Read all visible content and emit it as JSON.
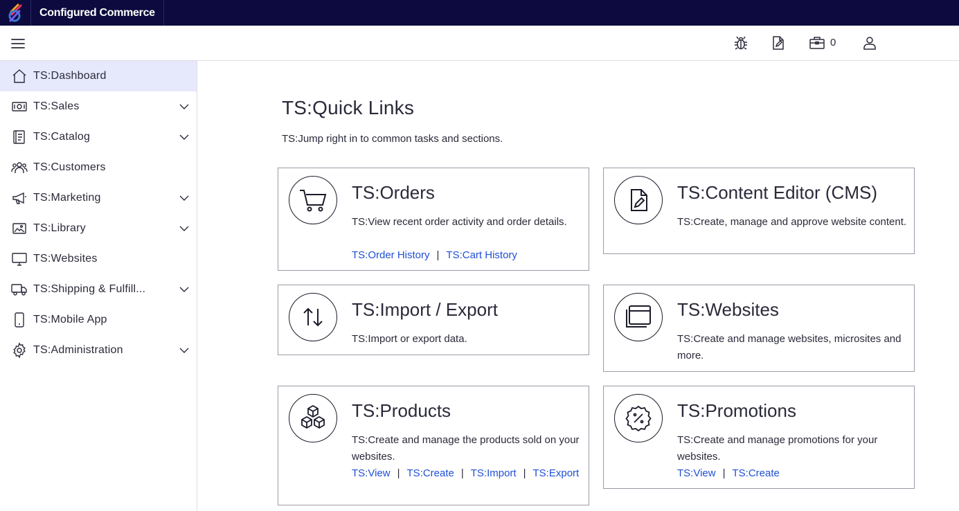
{
  "header": {
    "brand": "Configured Commerce",
    "cart_count": "0"
  },
  "icons": {
    "logo": "brand-logo-icon",
    "menu": "hamburger-menu-icon",
    "bug": "bug-icon",
    "notes": "document-edit-icon",
    "cart": "briefcase-cart-icon",
    "user": "user-icon"
  },
  "sidebar": {
    "items": [
      {
        "label": "TS:Dashboard",
        "icon": "home-icon",
        "active": true,
        "expandable": false
      },
      {
        "label": "TS:Sales",
        "icon": "money-icon",
        "expandable": true
      },
      {
        "label": "TS:Catalog",
        "icon": "catalog-icon",
        "expandable": true
      },
      {
        "label": "TS:Customers",
        "icon": "customers-icon",
        "expandable": false
      },
      {
        "label": "TS:Marketing",
        "icon": "megaphone-icon",
        "expandable": true
      },
      {
        "label": "TS:Library",
        "icon": "image-library-icon",
        "expandable": true
      },
      {
        "label": "TS:Websites",
        "icon": "monitor-icon",
        "expandable": false
      },
      {
        "label": "TS:Shipping & Fulfill...",
        "icon": "truck-icon",
        "expandable": true
      },
      {
        "label": "TS:Mobile App",
        "icon": "mobile-icon",
        "expandable": false
      },
      {
        "label": "TS:Administration",
        "icon": "gear-icon",
        "expandable": true
      }
    ]
  },
  "main": {
    "title": "TS:Quick Links",
    "subtitle": "TS:Jump right in to common tasks and sections.",
    "cards": {
      "orders": {
        "title": "TS:Orders",
        "description": "TS:View recent order activity and order details.",
        "links": [
          "TS:Order History",
          "TS:Cart History"
        ]
      },
      "cms": {
        "title": "TS:Content Editor (CMS)",
        "description": "TS:Create, manage and approve website content."
      },
      "import_export": {
        "title": "TS:Import / Export",
        "description": "TS:Import or export data."
      },
      "websites": {
        "title": "TS:Websites",
        "description": "TS:Create and manage websites, microsites and more."
      },
      "products": {
        "title": "TS:Products",
        "description": "TS:Create and manage the products sold on your websites.",
        "links": [
          "TS:View",
          "TS:Create",
          "TS:Import",
          "TS:Export"
        ]
      },
      "promotions": {
        "title": "TS:Promotions",
        "description": "TS:Create and manage promotions for your websites.",
        "links": [
          "TS:View",
          "TS:Create"
        ]
      }
    }
  },
  "colors": {
    "topbar": "#0c0a3e",
    "active_nav": "#e6e8fb",
    "link": "#1f4fd6"
  }
}
